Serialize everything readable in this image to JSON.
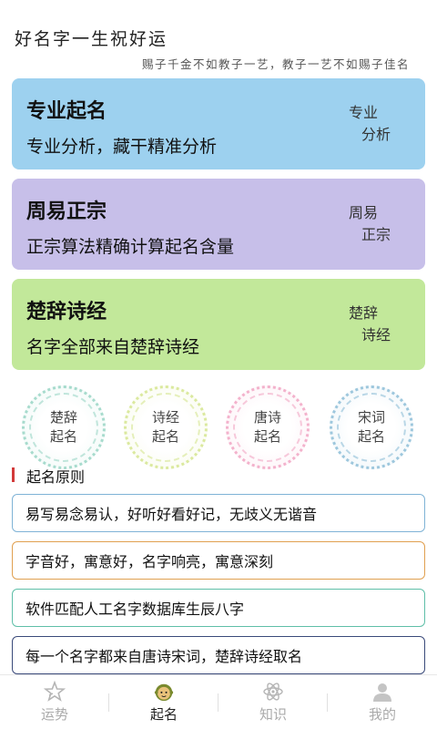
{
  "header": {
    "title": "好名字一生祝好运",
    "subtitle": "赐子千金不如教子一艺，教子一艺不如赐子佳名"
  },
  "cards": [
    {
      "title": "专业起名",
      "desc": "专业分析，藏干精准分析",
      "side": [
        "专业",
        "分析"
      ],
      "color": "#9dd1ef"
    },
    {
      "title": "周易正宗",
      "desc": "正宗算法精确计算起名含量",
      "side": [
        "周易",
        "正宗"
      ],
      "color": "#c7bfe9"
    },
    {
      "title": "楚辞诗经",
      "desc": "名字全部来自楚辞诗经",
      "side": [
        "楚辞",
        "诗经"
      ],
      "color": "#c2e89a"
    }
  ],
  "circles": [
    {
      "label": "楚辞起名",
      "color": "#9ad6c6"
    },
    {
      "label": "诗经起名",
      "color": "#d6e691"
    },
    {
      "label": "唐诗起名",
      "color": "#f2a7c5"
    },
    {
      "label": "宋词起名",
      "color": "#8fbfd8"
    }
  ],
  "section": {
    "title": "起名原则",
    "accent": "#d23a3a"
  },
  "rules": [
    {
      "text": "易写易念易认，好听好看好记，无歧义无谐音",
      "color": "#7fb3d6"
    },
    {
      "text": "字音好，寓意好，名字响亮，寓意深刻",
      "color": "#e0a050"
    },
    {
      "text": "软件匹配人工名字数据库生辰八字",
      "color": "#5fbfa8"
    },
    {
      "text": "每一个名字都来自唐诗宋词，楚辞诗经取名",
      "color": "#3a4a7a"
    }
  ],
  "tabs": [
    {
      "label": "运势",
      "icon": "star-icon",
      "active": false
    },
    {
      "label": "起名",
      "icon": "baby-face-icon",
      "active": true
    },
    {
      "label": "知识",
      "icon": "atom-icon",
      "active": false
    },
    {
      "label": "我的",
      "icon": "user-icon",
      "active": false
    }
  ]
}
